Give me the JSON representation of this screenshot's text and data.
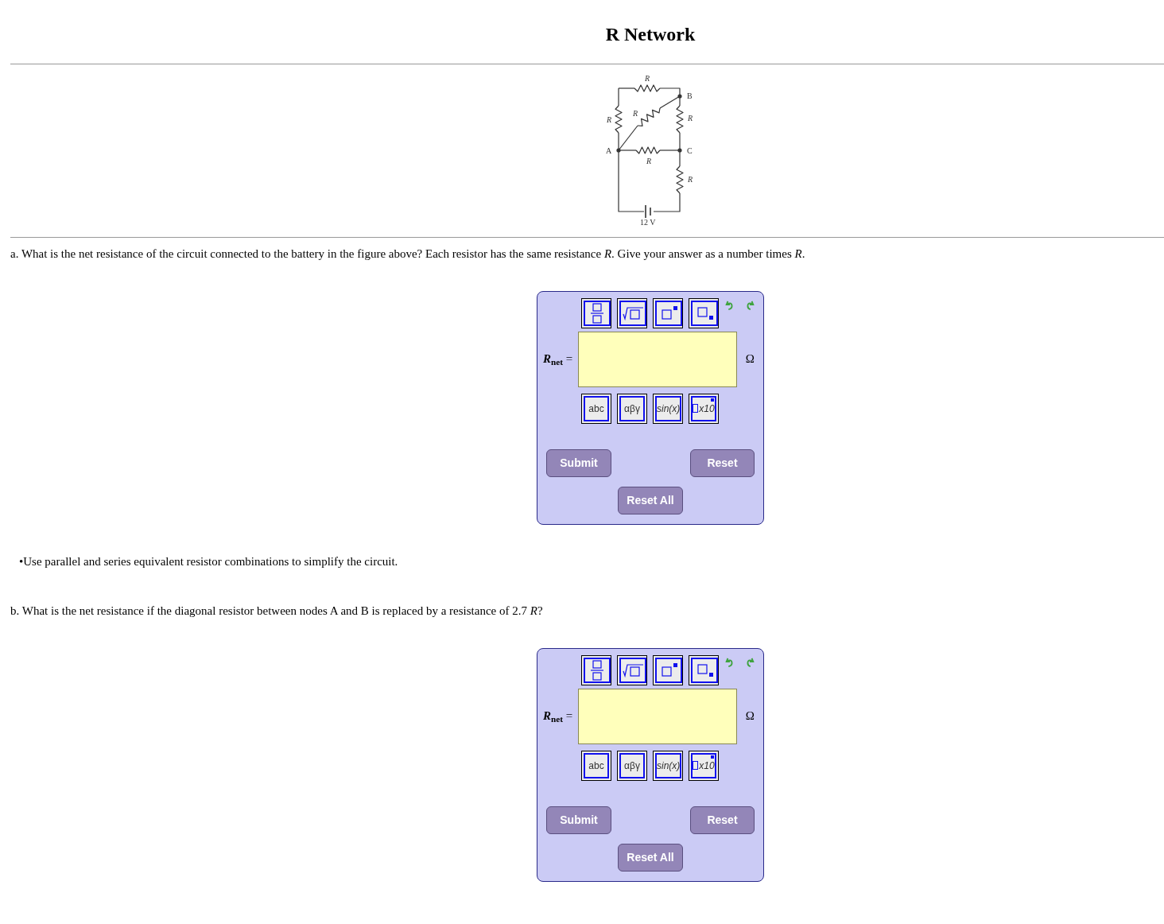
{
  "title": "R Network",
  "figure": {
    "resistor_labels": [
      "R",
      "R",
      "R",
      "R",
      "R",
      "R"
    ],
    "node_labels": [
      "A",
      "B",
      "C"
    ],
    "battery_label": "12 V"
  },
  "questions": [
    {
      "text": "a. What is the net resistance of the circuit connected to the battery in the figure above? Each resistor has the same resistance *R*. Give your answer as a number times *R*.",
      "hint": "•Use parallel and series equivalent resistor combinations to simplify the circuit.",
      "answer": {
        "symbol": "R",
        "subscript": "net",
        "equals": "=",
        "unit": "Ω",
        "palette": [
          "abc",
          "αβγ",
          "sin(x)",
          "x10"
        ],
        "buttons": [
          "Submit",
          "Reset",
          "Reset All"
        ]
      }
    },
    {
      "text": "b. What is the net resistance if the diagonal resistor between nodes A and B is replaced by a resistance of 2.7 *R*?",
      "answer": {
        "symbol": "R",
        "subscript": "net",
        "equals": "=",
        "unit": "Ω",
        "palette": [
          "abc",
          "αβγ",
          "sin(x)",
          "x10"
        ],
        "buttons": [
          "Submit",
          "Reset",
          "Reset All"
        ]
      }
    }
  ]
}
